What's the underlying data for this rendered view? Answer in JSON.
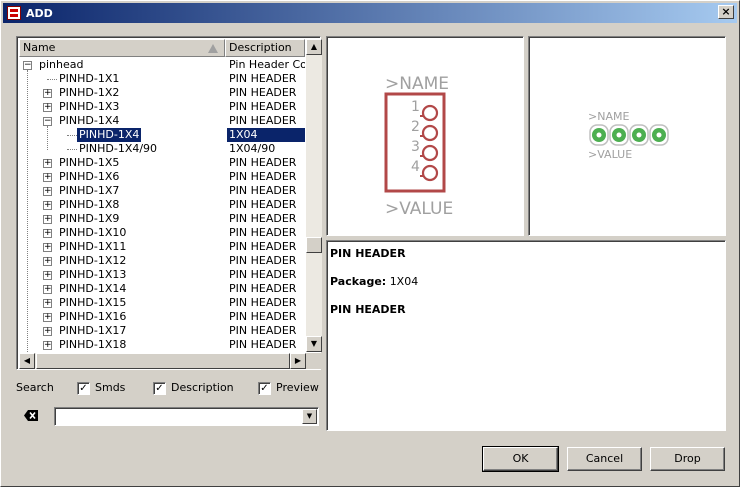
{
  "window": {
    "title": "ADD",
    "close_glyph": "×"
  },
  "tree": {
    "columns": {
      "name": "Name",
      "description": "Description"
    },
    "rows": [
      {
        "name": "pinhead",
        "desc": "Pin Header Conn",
        "level": 0,
        "toggle": "−"
      },
      {
        "name": "PINHD-1X1",
        "desc": "PIN HEADER",
        "level": 1,
        "toggle": ""
      },
      {
        "name": "PINHD-1X2",
        "desc": "PIN HEADER",
        "level": 1,
        "toggle": "+"
      },
      {
        "name": "PINHD-1X3",
        "desc": "PIN HEADER",
        "level": 1,
        "toggle": "+"
      },
      {
        "name": "PINHD-1X4",
        "desc": "PIN HEADER",
        "level": 1,
        "toggle": "−"
      },
      {
        "name": "PINHD-1X4",
        "desc": "1X04",
        "level": 2,
        "toggle": "",
        "selected": true
      },
      {
        "name": "PINHD-1X4/90",
        "desc": "1X04/90",
        "level": 2,
        "toggle": ""
      },
      {
        "name": "PINHD-1X5",
        "desc": "PIN HEADER",
        "level": 1,
        "toggle": "+"
      },
      {
        "name": "PINHD-1X6",
        "desc": "PIN HEADER",
        "level": 1,
        "toggle": "+"
      },
      {
        "name": "PINHD-1X7",
        "desc": "PIN HEADER",
        "level": 1,
        "toggle": "+"
      },
      {
        "name": "PINHD-1X8",
        "desc": "PIN HEADER",
        "level": 1,
        "toggle": "+"
      },
      {
        "name": "PINHD-1X9",
        "desc": "PIN HEADER",
        "level": 1,
        "toggle": "+"
      },
      {
        "name": "PINHD-1X10",
        "desc": "PIN HEADER",
        "level": 1,
        "toggle": "+"
      },
      {
        "name": "PINHD-1X11",
        "desc": "PIN HEADER",
        "level": 1,
        "toggle": "+"
      },
      {
        "name": "PINHD-1X12",
        "desc": "PIN HEADER",
        "level": 1,
        "toggle": "+"
      },
      {
        "name": "PINHD-1X13",
        "desc": "PIN HEADER",
        "level": 1,
        "toggle": "+"
      },
      {
        "name": "PINHD-1X14",
        "desc": "PIN HEADER",
        "level": 1,
        "toggle": "+"
      },
      {
        "name": "PINHD-1X15",
        "desc": "PIN HEADER",
        "level": 1,
        "toggle": "+"
      },
      {
        "name": "PINHD-1X16",
        "desc": "PIN HEADER",
        "level": 1,
        "toggle": "+"
      },
      {
        "name": "PINHD-1X17",
        "desc": "PIN HEADER",
        "level": 1,
        "toggle": "+"
      },
      {
        "name": "PINHD-1X18",
        "desc": "PIN HEADER",
        "level": 1,
        "toggle": "+"
      }
    ]
  },
  "options": {
    "search_label": "Search",
    "smds": {
      "label": "Smds",
      "checked": true
    },
    "description": {
      "label": "Description",
      "checked": true
    },
    "preview": {
      "label": "Preview",
      "checked": true
    },
    "check_glyph": "✓"
  },
  "search_combo": {
    "value": ""
  },
  "symbol_preview": {
    "name_label": ">NAME",
    "value_label": ">VALUE",
    "pins": [
      "1",
      "2",
      "3",
      "4"
    ],
    "body_color": "#b24848",
    "pin_color": "#b24848",
    "text_color": "#a0a0a0"
  },
  "package_preview": {
    "name_label": ">NAME",
    "value_label": ">VALUE",
    "pad_count": 4,
    "pad_color": "#4caf50",
    "outline_color": "#c0c0c0"
  },
  "info": {
    "heading": "PIN HEADER",
    "package_label": "Package:",
    "package_value": "1X04",
    "description": "PIN HEADER"
  },
  "buttons": {
    "ok": "OK",
    "cancel": "Cancel",
    "drop": "Drop"
  },
  "scroll": {
    "up": "▲",
    "down": "▼",
    "left": "◀",
    "right": "▶",
    "combo_down": "▼"
  }
}
